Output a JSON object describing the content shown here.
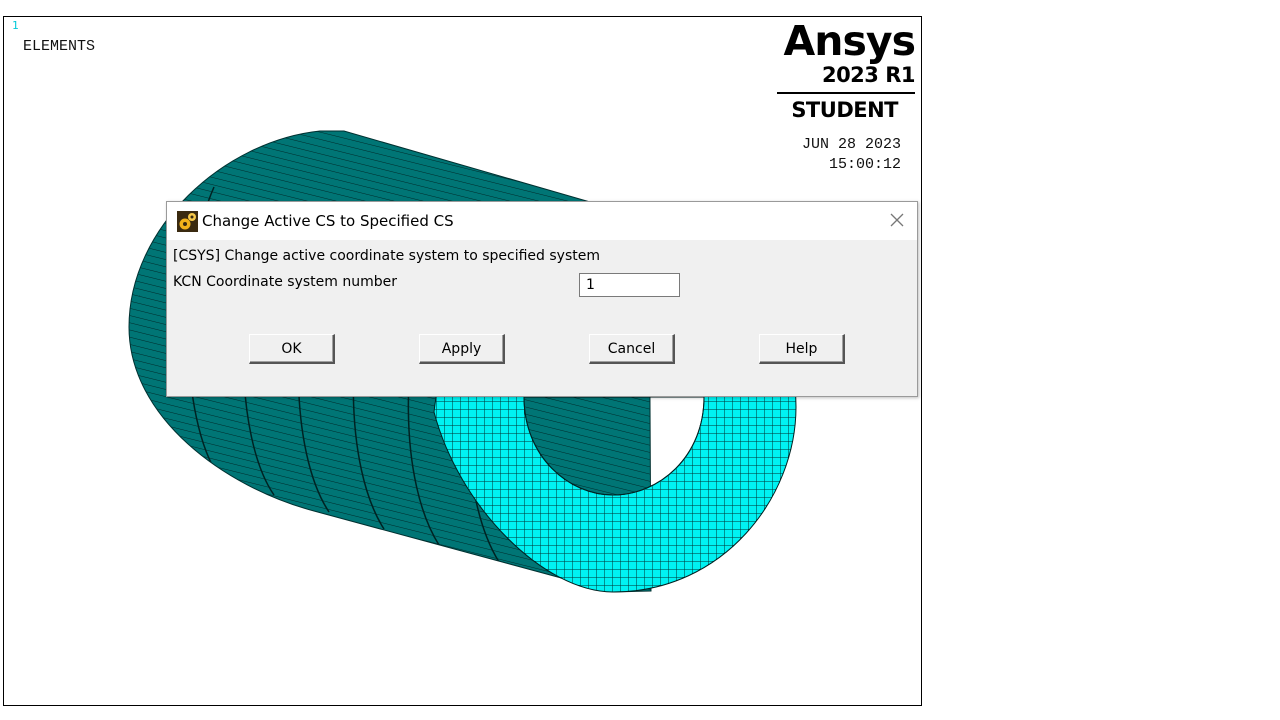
{
  "graphics": {
    "window_number": "1",
    "plot_title": "ELEMENTS",
    "logo": {
      "brand": "Ansys",
      "version": "2023 R1",
      "edition": "STUDENT"
    },
    "date": "JUN 28 2023",
    "time": "15:00:12",
    "colors": {
      "mesh_side": "#006e6e",
      "mesh_face": "#00f0f0",
      "mesh_lines": "#002828"
    }
  },
  "dialog": {
    "title": "Change Active CS to Specified CS",
    "description": "[CSYS]  Change active coordinate system to specified system",
    "field_label": "KCN  Coordinate system number",
    "field_value": "1",
    "buttons": {
      "ok": "OK",
      "apply": "Apply",
      "cancel": "Cancel",
      "help": "Help"
    },
    "icons": {
      "title": "gears-icon",
      "close": "close-icon"
    }
  }
}
